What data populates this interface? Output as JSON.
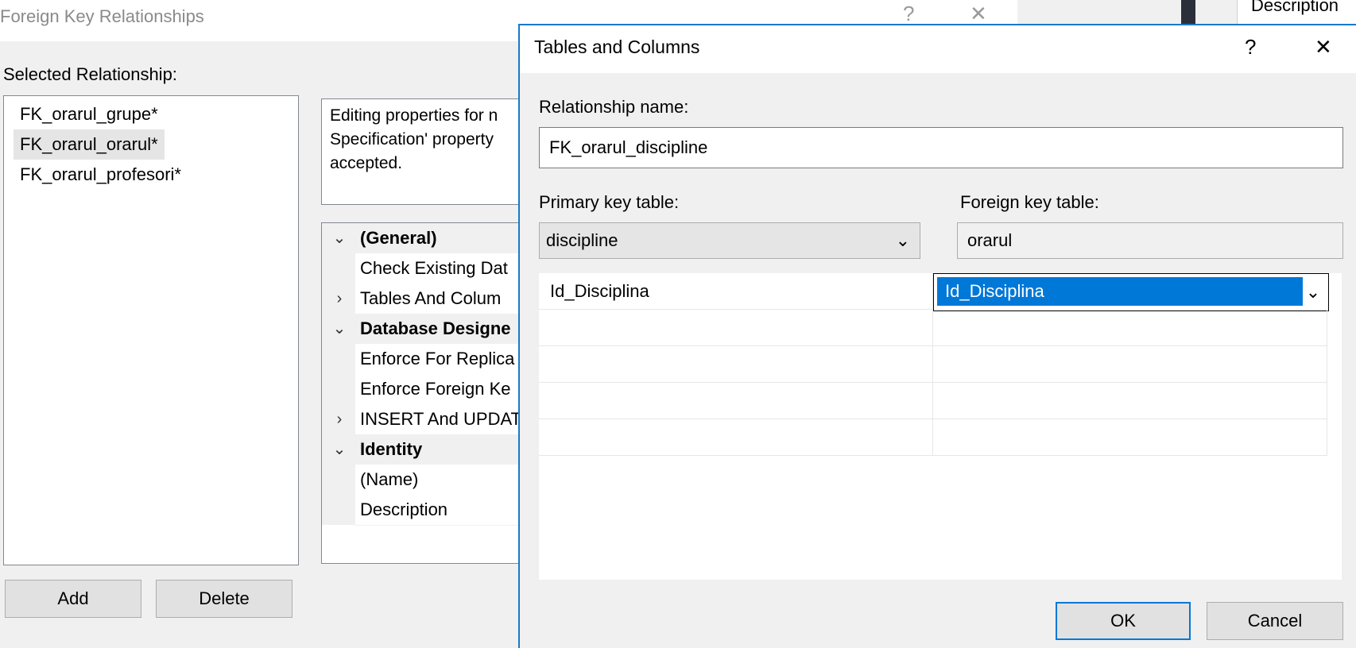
{
  "background_dialog": {
    "title": "Foreign Key Relationships",
    "help_glyph": "?",
    "close_glyph": "✕",
    "selected_relationship_label": "Selected Relationship:",
    "relationships": [
      {
        "label": "FK_orarul_grupe*",
        "selected": false
      },
      {
        "label": "FK_orarul_orarul*",
        "selected": true
      },
      {
        "label": "FK_orarul_profesori*",
        "selected": false
      }
    ],
    "description_text": "Editing properties for n\nSpecification' property\naccepted.",
    "properties": [
      {
        "kind": "category",
        "glyph": "⌄",
        "label": "(General)"
      },
      {
        "kind": "item",
        "glyph": "",
        "label": "Check Existing Dat"
      },
      {
        "kind": "item",
        "glyph": "›",
        "label": "Tables And Colum"
      },
      {
        "kind": "category",
        "glyph": "⌄",
        "label": "Database Designe"
      },
      {
        "kind": "item",
        "glyph": "",
        "label": "Enforce For Replica"
      },
      {
        "kind": "item",
        "glyph": "",
        "label": "Enforce Foreign Ke"
      },
      {
        "kind": "item",
        "glyph": "›",
        "label": "INSERT And UPDAT"
      },
      {
        "kind": "category",
        "glyph": "⌄",
        "label": "Identity"
      },
      {
        "kind": "item",
        "glyph": "",
        "label": "(Name)"
      },
      {
        "kind": "item",
        "glyph": "",
        "label": "Description"
      }
    ],
    "add_label": "Add",
    "delete_label": "Delete"
  },
  "right_sliver": {
    "text": "Description"
  },
  "tables_dialog": {
    "title": "Tables and Columns",
    "help_glyph": "?",
    "close_glyph": "✕",
    "relationship_name_label": "Relationship name:",
    "relationship_name_value": "FK_orarul_discipline",
    "primary_key_table_label": "Primary key table:",
    "primary_key_table_value": "discipline",
    "foreign_key_table_label": "Foreign key table:",
    "foreign_key_table_value": "orarul",
    "dropdown_glyph": "⌄",
    "column_rows": [
      {
        "primary": "Id_Disciplina",
        "foreign": "Id_Disciplina"
      },
      {
        "primary": "",
        "foreign": ""
      },
      {
        "primary": "",
        "foreign": ""
      },
      {
        "primary": "",
        "foreign": ""
      },
      {
        "primary": "",
        "foreign": ""
      }
    ],
    "ok_label": "OK",
    "cancel_label": "Cancel"
  }
}
